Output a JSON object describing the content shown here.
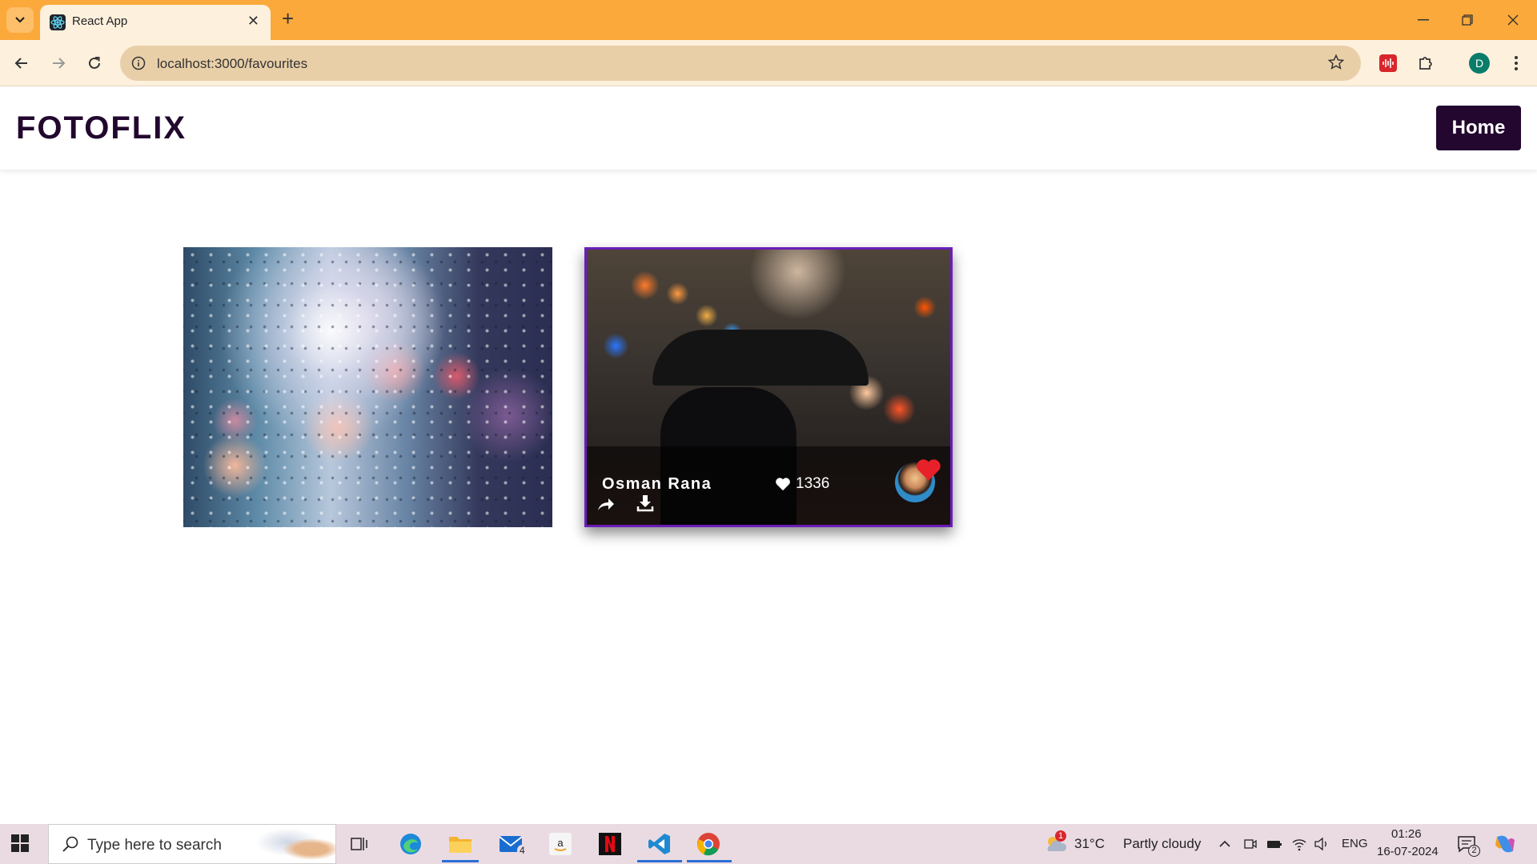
{
  "browser": {
    "tab_title": "React App",
    "url": "localhost:3000/favourites",
    "profile_initial": "D"
  },
  "app": {
    "brand": "FOTOFLIX",
    "home_label": "Home"
  },
  "cards": [
    {
      "id": "rain-window",
      "hover_visible": false
    },
    {
      "id": "umbrella-street",
      "author": "Osman Rana",
      "likes": "1336",
      "favourite": true
    }
  ],
  "taskbar": {
    "search_placeholder": "Type here to search",
    "mail_badge": "4",
    "weather_temp": "31°C",
    "weather_desc": "Partly cloudy",
    "weather_badge": "1",
    "language": "ENG",
    "time": "01:26",
    "date": "16-07-2024",
    "notification_count": "2"
  },
  "colors": {
    "accent": "#23072f",
    "chrome_tabstrip": "#fba93a",
    "card_border": "#6a1db8",
    "heart": "#e8202a"
  }
}
